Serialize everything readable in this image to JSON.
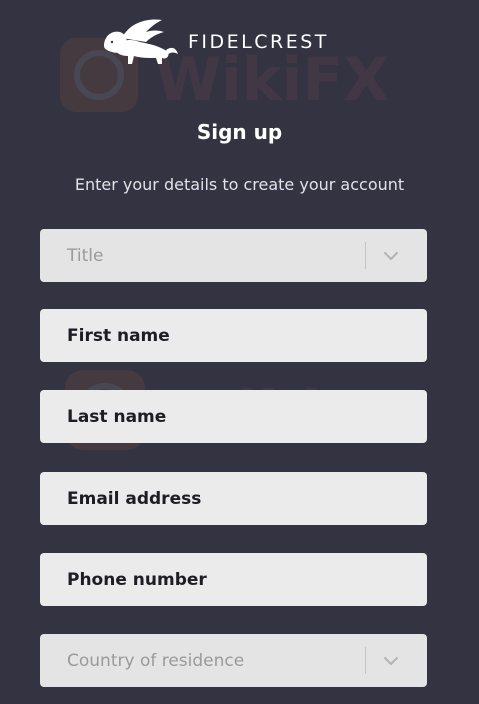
{
  "brand": {
    "name": "FIDELCREST",
    "logo_icon": "winged-lion-icon"
  },
  "form": {
    "title": "Sign up",
    "subtitle": "Enter your details to create your account",
    "fields": [
      {
        "name": "title-select",
        "label": "Title",
        "type": "select"
      },
      {
        "name": "first-name-input",
        "label": "First name",
        "type": "text"
      },
      {
        "name": "last-name-input",
        "label": "Last name",
        "type": "text"
      },
      {
        "name": "email-input",
        "label": "Email address",
        "type": "text"
      },
      {
        "name": "phone-input",
        "label": "Phone number",
        "type": "text"
      },
      {
        "name": "country-select",
        "label": "Country of residence",
        "type": "select"
      }
    ]
  },
  "watermark": {
    "text": "WikiFX"
  },
  "colors": {
    "background": "#333342",
    "field": "#ebebeb",
    "text_dark": "#1d1d24",
    "placeholder": "#9a9a9a"
  }
}
